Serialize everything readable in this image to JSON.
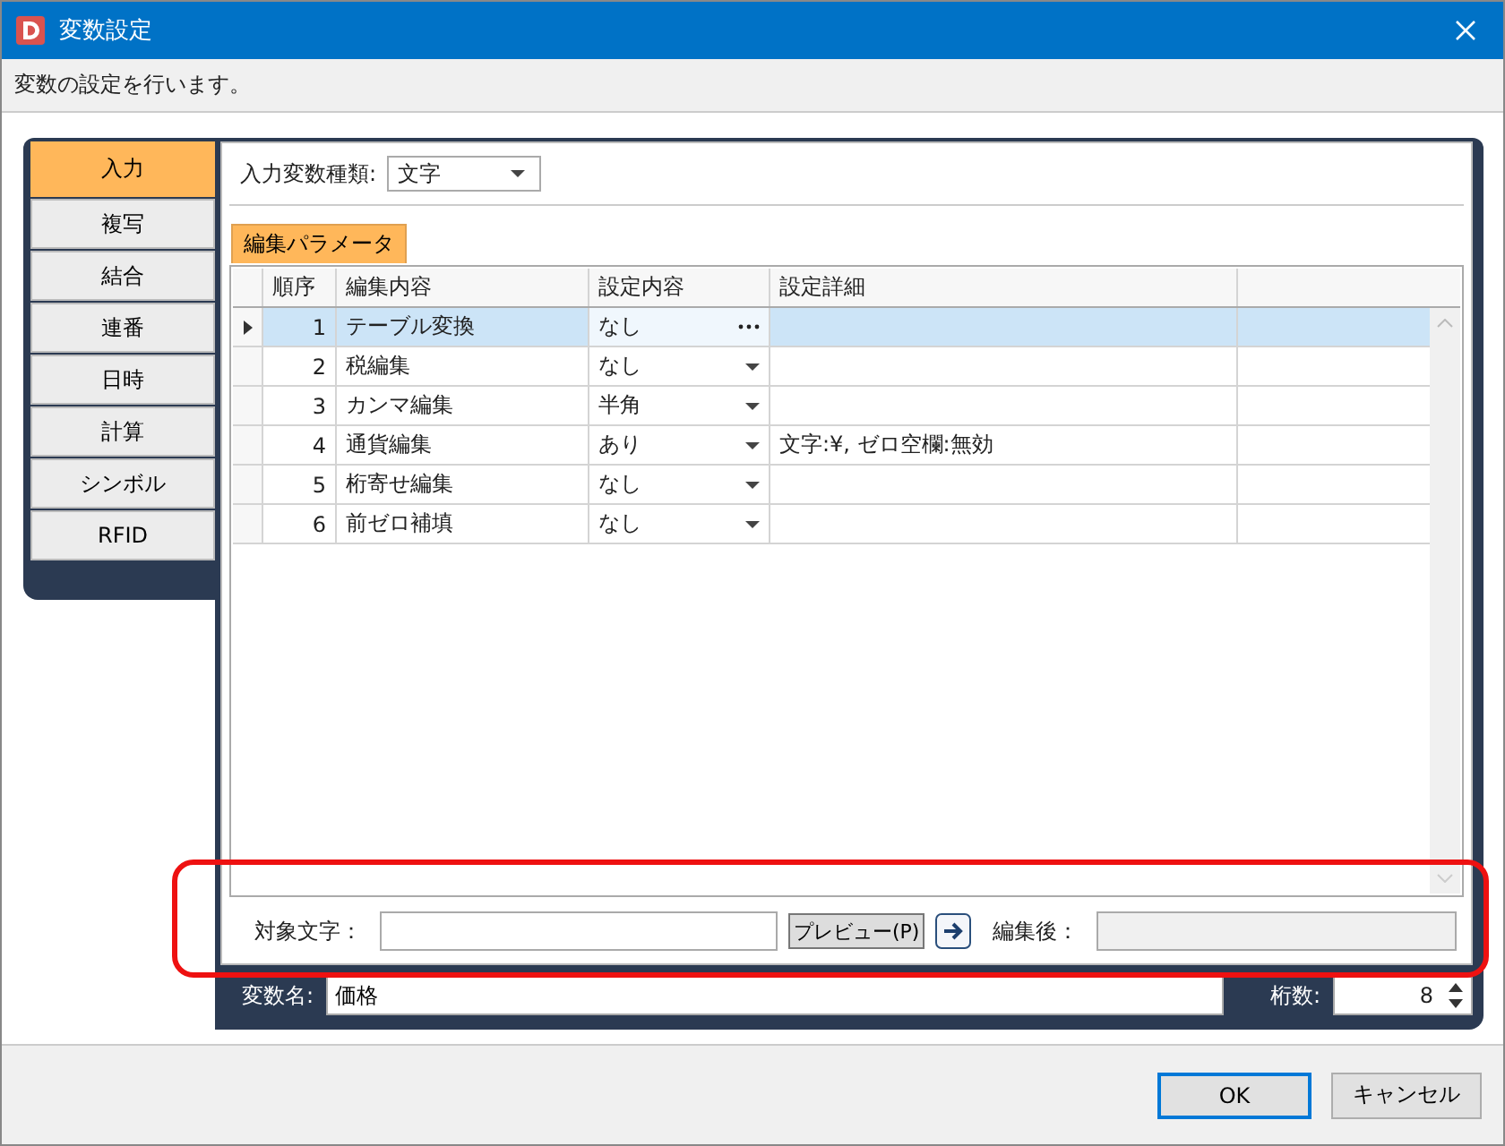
{
  "window": {
    "title": "変数設定",
    "description": "変数の設定を行います。"
  },
  "side_tabs": [
    {
      "label": "入力",
      "selected": true
    },
    {
      "label": "複写",
      "selected": false
    },
    {
      "label": "結合",
      "selected": false
    },
    {
      "label": "連番",
      "selected": false
    },
    {
      "label": "日時",
      "selected": false
    },
    {
      "label": "計算",
      "selected": false
    },
    {
      "label": "シンボル",
      "selected": false
    },
    {
      "label": "RFID",
      "selected": false
    }
  ],
  "input_type": {
    "label": "入力変数種類:",
    "value": "文字"
  },
  "sub_tabs": [
    {
      "label": "編集パラメータ",
      "selected": true
    }
  ],
  "grid": {
    "columns": [
      "順序",
      "編集内容",
      "設定内容",
      "設定詳細"
    ],
    "rows": [
      {
        "order": "1",
        "item": "テーブル変換",
        "setting": "なし",
        "detail": "",
        "kind": "ellipsis",
        "selected": true
      },
      {
        "order": "2",
        "item": "税編集",
        "setting": "なし",
        "detail": "",
        "kind": "dropdown",
        "selected": false
      },
      {
        "order": "3",
        "item": "カンマ編集",
        "setting": "半角",
        "detail": "",
        "kind": "dropdown",
        "selected": false
      },
      {
        "order": "4",
        "item": "通貨編集",
        "setting": "あり",
        "detail": "文字:¥, ゼロ空欄:無効",
        "kind": "dropdown",
        "selected": false
      },
      {
        "order": "5",
        "item": "桁寄せ編集",
        "setting": "なし",
        "detail": "",
        "kind": "dropdown",
        "selected": false
      },
      {
        "order": "6",
        "item": "前ゼロ補填",
        "setting": "なし",
        "detail": "",
        "kind": "dropdown",
        "selected": false
      }
    ]
  },
  "preview": {
    "target_label": "対象文字：",
    "preview_button": "プレビュー(P)",
    "result_label": "編集後："
  },
  "variable": {
    "name_label": "変数名:",
    "name_value": "価格",
    "digits_label": "桁数:",
    "digits_value": "8"
  },
  "buttons": [
    {
      "label": "OK",
      "default": true
    },
    {
      "label": "キャンセル",
      "default": false
    }
  ]
}
